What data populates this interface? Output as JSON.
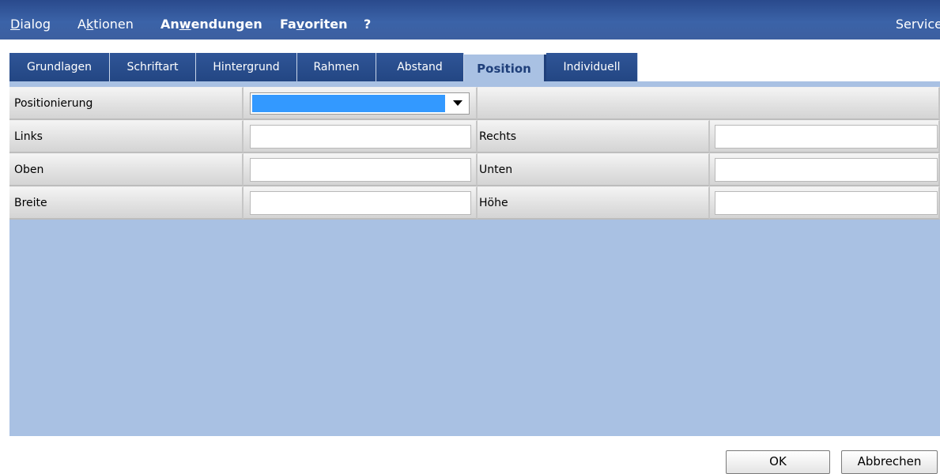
{
  "menubar": {
    "items": [
      {
        "pre": "",
        "u": "D",
        "post": "ialog",
        "bold": false
      },
      {
        "pre": "A",
        "u": "k",
        "post": "tionen",
        "bold": false
      },
      {
        "pre": "An",
        "u": "w",
        "post": "endungen",
        "bold": true
      },
      {
        "pre": "Fa",
        "u": "v",
        "post": "oriten",
        "bold": true
      },
      {
        "pre": "?",
        "u": "",
        "post": "",
        "bold": true
      }
    ],
    "right_label": "Service"
  },
  "tabs": [
    "Grundlagen",
    "Schriftart",
    "Hintergrund",
    "Rahmen",
    "Abstand",
    "Position",
    "Individuell"
  ],
  "active_tab": "Position",
  "form": {
    "positionierung_label": "Positionierung",
    "positionierung_value": "",
    "links_label": "Links",
    "links_value": "",
    "rechts_label": "Rechts",
    "rechts_value": "",
    "oben_label": "Oben",
    "oben_value": "",
    "unten_label": "Unten",
    "unten_value": "",
    "breite_label": "Breite",
    "breite_value": "",
    "hoehe_label": "Höhe",
    "hoehe_value": ""
  },
  "buttons": {
    "ok": "OK",
    "cancel": "Abbrechen"
  },
  "colors": {
    "menubar": "#3b63a8",
    "tab": "#2f5597",
    "active_tab": "#a9c1e3",
    "panel": "#a9c1e3",
    "selection": "#3399ff"
  }
}
